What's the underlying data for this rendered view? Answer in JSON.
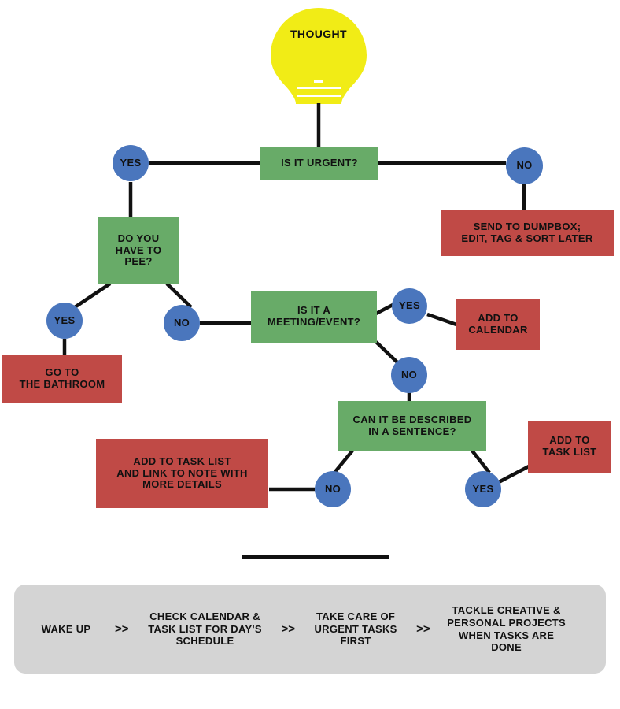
{
  "diagram": {
    "title": "Thought processing flowchart",
    "colors": {
      "green": "#68ab68",
      "red": "#c04a46",
      "blue": "#4a76bd",
      "yellow": "#f1ec16",
      "grey": "#d4d4d4",
      "line": "#111111"
    },
    "start": {
      "icon": "lightbulb-icon",
      "label": "THOUGHT"
    },
    "decisions": [
      {
        "id": "urgent",
        "label": "IS IT URGENT?"
      },
      {
        "id": "pee",
        "label": "DO YOU\nHAVE TO\nPEE?"
      },
      {
        "id": "meeting",
        "label": "IS IT A\nMEETING/EVENT?"
      },
      {
        "id": "sentence",
        "label": "CAN IT BE DESCRIBED\nIN A SENTENCE?"
      }
    ],
    "answers": [
      {
        "id": "urgent-yes",
        "label": "YES"
      },
      {
        "id": "urgent-no",
        "label": "NO"
      },
      {
        "id": "pee-yes",
        "label": "YES"
      },
      {
        "id": "pee-no",
        "label": "NO"
      },
      {
        "id": "meeting-yes",
        "label": "YES"
      },
      {
        "id": "meeting-no",
        "label": "NO"
      },
      {
        "id": "sentence-no",
        "label": "NO"
      },
      {
        "id": "sentence-yes",
        "label": "YES"
      }
    ],
    "outcomes": [
      {
        "id": "dumpbox",
        "label": "SEND TO DUMPBOX;\nEDIT, TAG & SORT LATER"
      },
      {
        "id": "bathroom",
        "label": "GO TO\nTHE BATHROOM"
      },
      {
        "id": "calendar",
        "label": "ADD TO\nCALENDAR"
      },
      {
        "id": "task-link",
        "label": "ADD TO TASK LIST\nAND LINK TO NOTE WITH\nMORE DETAILS"
      },
      {
        "id": "task-list",
        "label": "ADD TO\nTASK LIST"
      }
    ]
  },
  "timeline": {
    "separator_symbol": ">>",
    "steps": [
      {
        "id": "wake-up",
        "label": "WAKE UP"
      },
      {
        "id": "check",
        "label": "CHECK CALENDAR &\nTASK LIST FOR DAY'S\nSCHEDULE"
      },
      {
        "id": "urgent",
        "label": "TAKE CARE OF\nURGENT TASKS\nFIRST"
      },
      {
        "id": "creative",
        "label": "TACKLE CREATIVE &\nPERSONAL PROJECTS\nWHEN TASKS ARE\nDONE"
      }
    ]
  }
}
